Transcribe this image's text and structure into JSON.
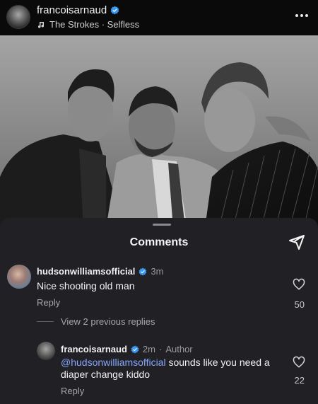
{
  "header": {
    "username": "francoisarnaud",
    "music": "The Strokes · Selfless"
  },
  "sheet": {
    "title": "Comments"
  },
  "comments": [
    {
      "username": "hudsonwilliamsofficial",
      "time": "3m",
      "text": "Nice shooting old man",
      "reply_label": "Reply",
      "likes": "50",
      "view_replies": "View 2 previous replies"
    },
    {
      "username": "francoisarnaud",
      "time": "2m",
      "author_tag": "Author",
      "mention": "@hudsonwilliamsofficial",
      "text": " sounds like you need a diaper change kiddo",
      "reply_label": "Reply",
      "likes": "22"
    }
  ],
  "colors": {
    "background": "#000000",
    "sheet": "#212125",
    "mention": "#86a6ff",
    "verified": "#3897f0"
  }
}
